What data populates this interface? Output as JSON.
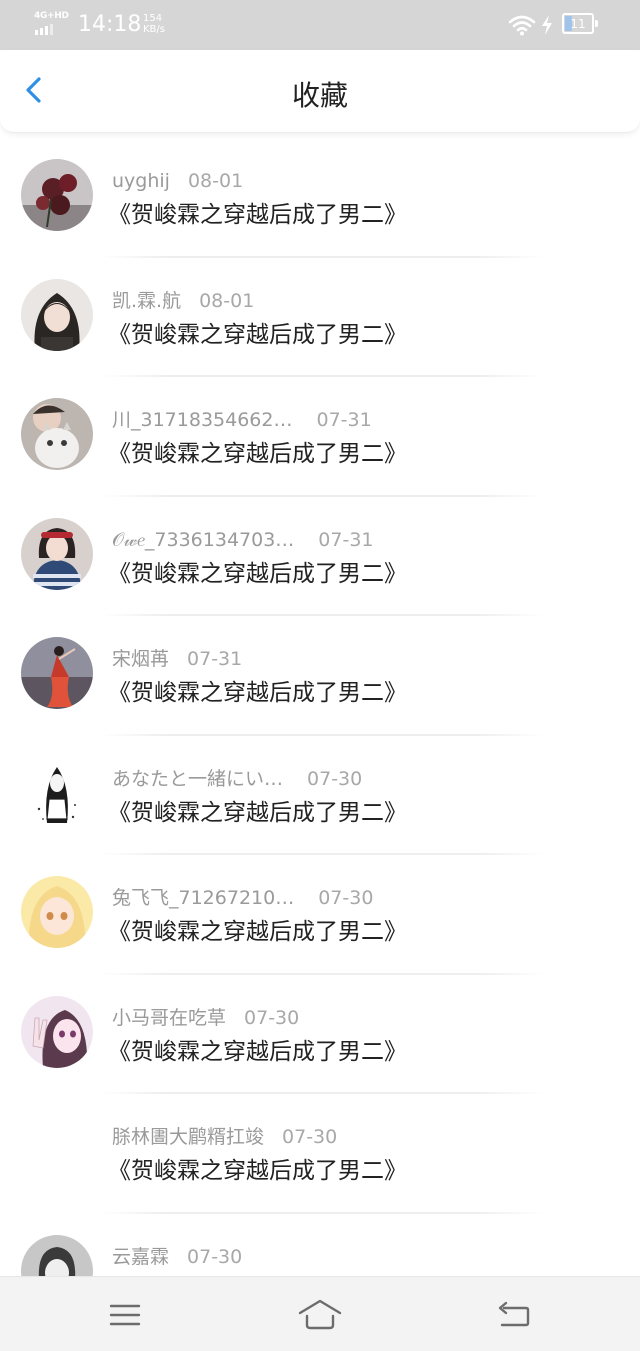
{
  "status_bar": {
    "network": "4G+HD",
    "time": "14:18",
    "speed_value": "154",
    "speed_unit": "KB/s",
    "battery": "11",
    "icons": [
      "signal-icon",
      "wifi-icon",
      "charging-icon",
      "battery-icon"
    ]
  },
  "header": {
    "title": "收藏",
    "back_icon": "chevron-left-icon",
    "accent_color": "#2f8fe6"
  },
  "items": [
    {
      "user": "uyghij",
      "date": "08-01",
      "title": "《贺峻霖之穿越后成了男二》",
      "avatar": "roses"
    },
    {
      "user": "凯.霖.航",
      "date": "08-01",
      "title": "《贺峻霖之穿越后成了男二》",
      "avatar": "girl-dark-hair"
    },
    {
      "user": "川_31718354662…",
      "date": "07-31",
      "title": "《贺峻霖之穿越后成了男二》",
      "avatar": "girl-with-cat"
    },
    {
      "user": "𝒪𝓌𝑒_7336134703…",
      "date": "07-31",
      "title": "《贺峻霖之穿越后成了男二》",
      "avatar": "girl-red-headband"
    },
    {
      "user": "宋烟苒",
      "date": "07-31",
      "title": "《贺峻霖之穿越后成了男二》",
      "avatar": "dancer-red-dress"
    },
    {
      "user": "あなたと一緒にい…",
      "date": "07-30",
      "title": "《贺峻霖之穿越后成了男二》",
      "avatar": "sketch-girl"
    },
    {
      "user": "兔飞飞_71267210…",
      "date": "07-30",
      "title": "《贺峻霖之穿越后成了男二》",
      "avatar": "anime-blonde"
    },
    {
      "user": "小马哥在吃草",
      "date": "07-30",
      "title": "《贺峻霖之穿越后成了男二》",
      "avatar": "anime-pink"
    },
    {
      "user": "脎林圕大鹛糈扛竣",
      "date": "07-30",
      "title": "《贺峻霖之穿越后成了男二》",
      "avatar": ""
    },
    {
      "user": "云嘉霖",
      "date": "07-30",
      "title": "",
      "avatar": "boy-gray"
    }
  ],
  "bottom_nav": {
    "icons": [
      "menu-icon",
      "home-icon",
      "back-icon"
    ]
  },
  "colors": {
    "status_bar_bg": "#d6d6d6",
    "meta_text": "#9a9a9a",
    "title_text": "#222222",
    "nav_bg": "#f3f3f3"
  }
}
